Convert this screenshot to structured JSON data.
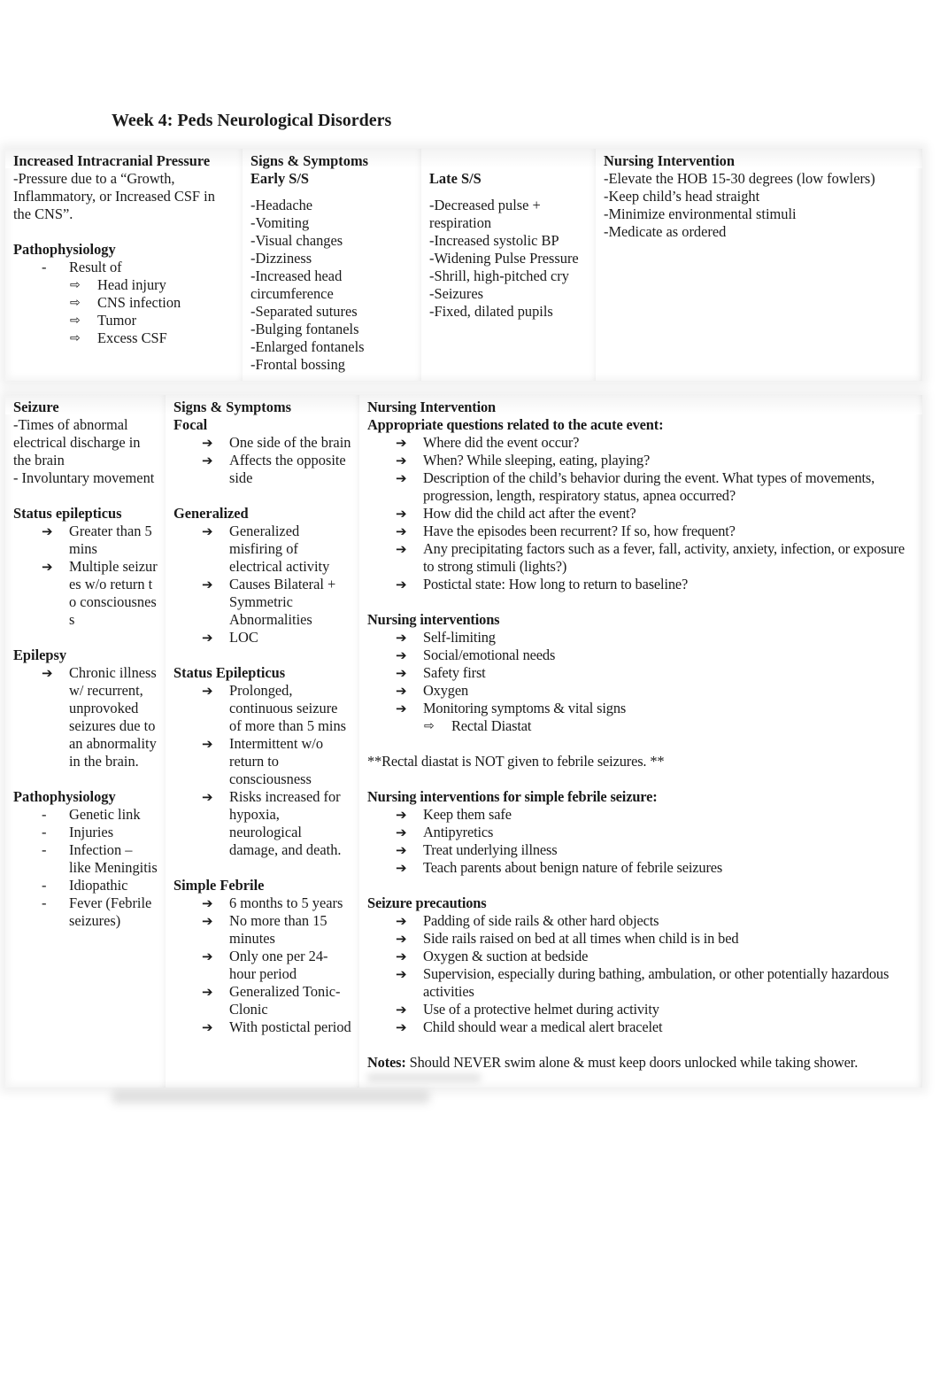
{
  "document": {
    "title": "Week 4: Peds Neurological Disorders"
  },
  "icp": {
    "heading": "Increased Intracranial Pressure",
    "definition": "-Pressure due to a “Growth, Inflammatory, or Increased CSF in the CNS”.",
    "patho_heading": "Pathophysiology",
    "patho_item": "Result of",
    "patho_subitems": [
      "Head injury",
      "CNS infection",
      "Tumor",
      "Excess CSF"
    ],
    "ss_heading": "Signs & Symptoms",
    "early_heading": "Early S/S",
    "early": [
      "-Headache",
      "-Vomiting",
      "-Visual changes",
      "-Dizziness",
      "-Increased head circumference",
      "-Separated sutures",
      "-Bulging fontanels",
      "-Enlarged fontanels",
      "-Frontal bossing"
    ],
    "late_heading": "Late S/S",
    "late": [
      "-Decreased pulse + respiration",
      "-Increased systolic BP",
      "-Widening Pulse Pressure",
      "-Shrill, high-pitched cry",
      "-Seizures",
      "-Fixed, dilated pupils"
    ],
    "ni_heading": "Nursing Intervention",
    "ni": [
      "-Elevate the HOB 15-30 degrees (low fowlers)",
      "-Keep child’s head straight",
      "-Minimize environmental stimuli",
      "-Medicate as ordered"
    ]
  },
  "seizure": {
    "heading": "Seizure",
    "definition": [
      "-Times of abnormal electrical discharge in the brain",
      "- Involuntary movement"
    ],
    "status_heading": "Status epilepticus",
    "status": [
      "Greater than 5 mins",
      "Multiple seizures w/o return to consciousness"
    ],
    "epilepsy_heading": "Epilepsy",
    "epilepsy": [
      "Chronic illness w/ recurrent, unprovoked seizures due to an abnormality in the brain."
    ],
    "patho_heading": "Pathophysiology",
    "patho": [
      "Genetic link",
      "Injuries",
      "Infection – like Meningitis",
      "Idiopathic",
      "Fever (Febrile seizures)"
    ],
    "ss_heading": "Signs & Symptoms",
    "focal_heading": "Focal",
    "focal": [
      "One side of the brain",
      "Affects the opposite side"
    ],
    "generalized_heading": "Generalized",
    "generalized": [
      "Generalized misfiring of electrical activity",
      "Causes Bilateral + Symmetric Abnormalities",
      "LOC"
    ],
    "status_ss_heading": "Status Epilepticus",
    "status_ss": [
      "Prolonged, continuous seizure of more than 5 mins",
      "Intermittent w/o return to consciousness",
      "Risks increased for hypoxia, neurological damage, and death."
    ],
    "febrile_heading": "Simple Febrile",
    "febrile": [
      "6 months to 5 years",
      "No more than 15 minutes",
      "Only one per 24-hour period",
      "Generalized Tonic-Clonic",
      "With postictal period"
    ],
    "ni_heading": "Nursing Intervention",
    "questions_heading": "Appropriate questions related to the acute event:",
    "questions": [
      "Where did the event occur?",
      "When? While sleeping, eating, playing?",
      "Description of the child’s behavior during the event. What types of movements, progression, length, respiratory status, apnea occurred?",
      "How did the child act after the event?",
      "Have the episodes been recurrent? If so, how frequent?",
      "Any precipitating factors such as a fever, fall, activity, anxiety, infection, or exposure to strong stimuli (lights?)",
      "Postictal state: How long to return to baseline?"
    ],
    "interventions_heading": "Nursing interventions",
    "interventions": [
      "Self-limiting",
      "Social/emotional needs",
      "Safety first",
      "Oxygen",
      "Monitoring symptoms & vital signs"
    ],
    "interventions_sub": [
      "Rectal Diastat"
    ],
    "rectal_note": "**Rectal diastat is NOT given to febrile seizures. **",
    "febrile_ni_heading": "Nursing interventions for simple febrile seizure:",
    "febrile_ni": [
      "Keep them safe",
      "Antipyretics",
      "Treat underlying illness",
      "Teach parents about benign nature of febrile seizures"
    ],
    "precautions_heading": "Seizure precautions",
    "precautions": [
      "Padding of side rails & other hard objects",
      "Side rails raised on bed at all times when child is in bed",
      "Oxygen & suction at bedside",
      "Supervision, especially during bathing, ambulation, or other potentially hazardous activities",
      "Use of a protective helmet during activity",
      "Child should wear a medical alert bracelet"
    ],
    "notes_label": "Notes:",
    "notes_text": " Should NEVER swim alone & must keep doors unlocked while taking shower."
  },
  "icons": {
    "arrow": "➔",
    "hollow_arrow": "⇨",
    "dash": "-"
  }
}
